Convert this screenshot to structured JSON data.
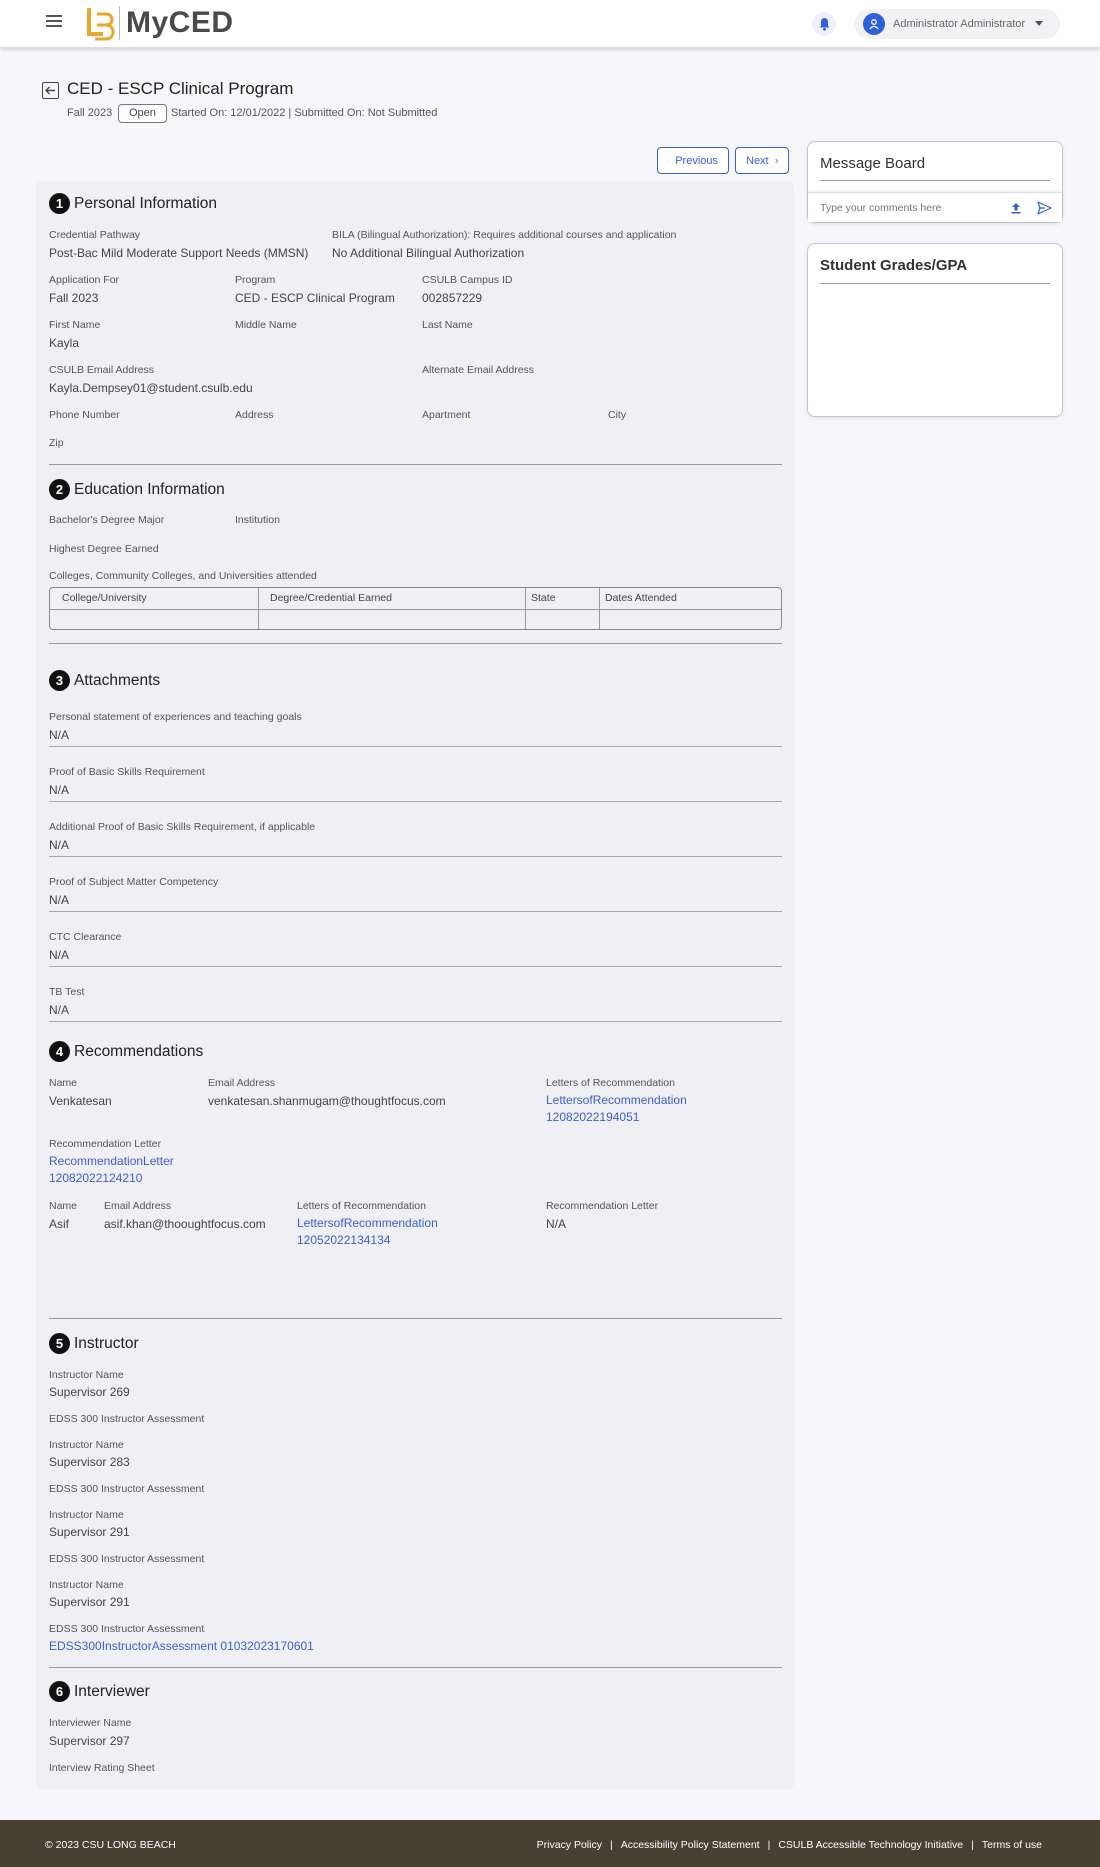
{
  "app": {
    "brand": "MyCED",
    "user_name": "Administrator Administrator"
  },
  "header": {
    "title": "CED - ESCP Clinical Program",
    "term": "Fall 2023",
    "status": "Open",
    "dates": "Started On: 12/01/2022 | Submitted On: Not Submitted"
  },
  "nav": {
    "previous": "Previous",
    "next": "Next"
  },
  "sections": {
    "personal": {
      "number": "1",
      "title": "Personal Information",
      "credential_pathway_label": "Credential Pathway",
      "credential_pathway_value": "Post-Bac Mild Moderate Support Needs (MMSN)",
      "bila_label": "BILA (Bilingual Authorization): Requires additional courses and application",
      "bila_value": "No Additional Bilingual Authorization",
      "application_for_label": "Application For",
      "application_for_value": "Fall 2023",
      "program_label": "Program",
      "program_value": "CED - ESCP Clinical Program",
      "campus_id_label": "CSULB Campus ID",
      "campus_id_value": "002857229",
      "first_name_label": "First Name",
      "first_name_value": "Kayla",
      "middle_name_label": "Middle Name",
      "last_name_label": "Last Name",
      "csulb_email_label": "CSULB Email Address",
      "csulb_email_value": "Kayla.Dempsey01@student.csulb.edu",
      "alt_email_label": "Alternate Email Address",
      "phone_label": "Phone Number",
      "address_label": "Address",
      "apartment_label": "Apartment",
      "city_label": "City",
      "zip_label": "Zip"
    },
    "education": {
      "number": "2",
      "title": "Education Information",
      "major_label": "Bachelor's Degree Major",
      "institution_label": "Institution",
      "highest_degree_label": "Highest Degree Earned",
      "colleges_label": "Colleges, Community Colleges, and Universities attended",
      "table_headers": [
        "College/University",
        "Degree/Credential Earned",
        "State",
        "Dates Attended"
      ]
    },
    "attachments": {
      "number": "3",
      "title": "Attachments",
      "items": [
        {
          "label": "Personal statement of experiences and teaching goals",
          "value": "N/A"
        },
        {
          "label": "Proof of Basic Skills Requirement",
          "value": "N/A"
        },
        {
          "label": "Additional Proof of Basic Skills Requirement, if applicable",
          "value": "N/A"
        },
        {
          "label": "Proof of Subject Matter Competency",
          "value": "N/A"
        },
        {
          "label": "CTC Clearance",
          "value": "N/A"
        },
        {
          "label": "TB Test",
          "value": "N/A"
        }
      ]
    },
    "recommendations": {
      "number": "4",
      "title": "Recommendations",
      "name_label": "Name",
      "email_label": "Email Address",
      "letters_label": "Letters of Recommendation",
      "rec_letter_label": "Recommendation Letter",
      "rec1": {
        "name": "Venkatesan",
        "email": "venkatesan.shanmugam@thoughtfocus.com",
        "letters_line1": "LettersofRecommendation",
        "letters_line2": "12082022194051",
        "rec_letter_line1": "RecommendationLetter",
        "rec_letter_line2": "12082022124210"
      },
      "rec2": {
        "name": "Asif",
        "email": "asif.khan@thooughtfocus.com",
        "letters_line1": "LettersofRecommendation",
        "letters_line2": "12052022134134",
        "rec_letter": "N/A"
      }
    },
    "instructor": {
      "number": "5",
      "title": "Instructor",
      "name_label": "Instructor Name",
      "assessment_label": "EDSS 300 Instructor Assessment",
      "names": [
        "Supervisor 269",
        "Supervisor 283",
        "Supervisor 291",
        "Supervisor 291"
      ],
      "assessment_link": "EDSS300InstructorAssessment 01032023170601"
    },
    "interviewer": {
      "number": "6",
      "title": "Interviewer",
      "name_label": "Interviewer Name",
      "name_value": "Supervisor 297",
      "rating_label": "Interview Rating Sheet"
    }
  },
  "sidebar": {
    "message_board_title": "Message Board",
    "comment_placeholder": "Type your comments here",
    "grades_title": "Student Grades/GPA"
  },
  "footer": {
    "copyright": "© 2023 CSU LONG BEACH",
    "links": [
      "Privacy Policy",
      "Accessibility Policy Statement",
      "CSULB Accessible Technology Initiative",
      "Terms of use"
    ],
    "separator": "|"
  },
  "colors": {
    "accent": "#3a5fd6",
    "footer_bg": "#4a3f33",
    "logo_gold": "#e8a92a"
  },
  "icons": [
    "menu-icon",
    "bell-icon",
    "user-icon",
    "caret-down-icon",
    "back-arrow-icon",
    "chevron-left-icon",
    "chevron-right-icon",
    "upload-icon",
    "send-icon"
  ]
}
